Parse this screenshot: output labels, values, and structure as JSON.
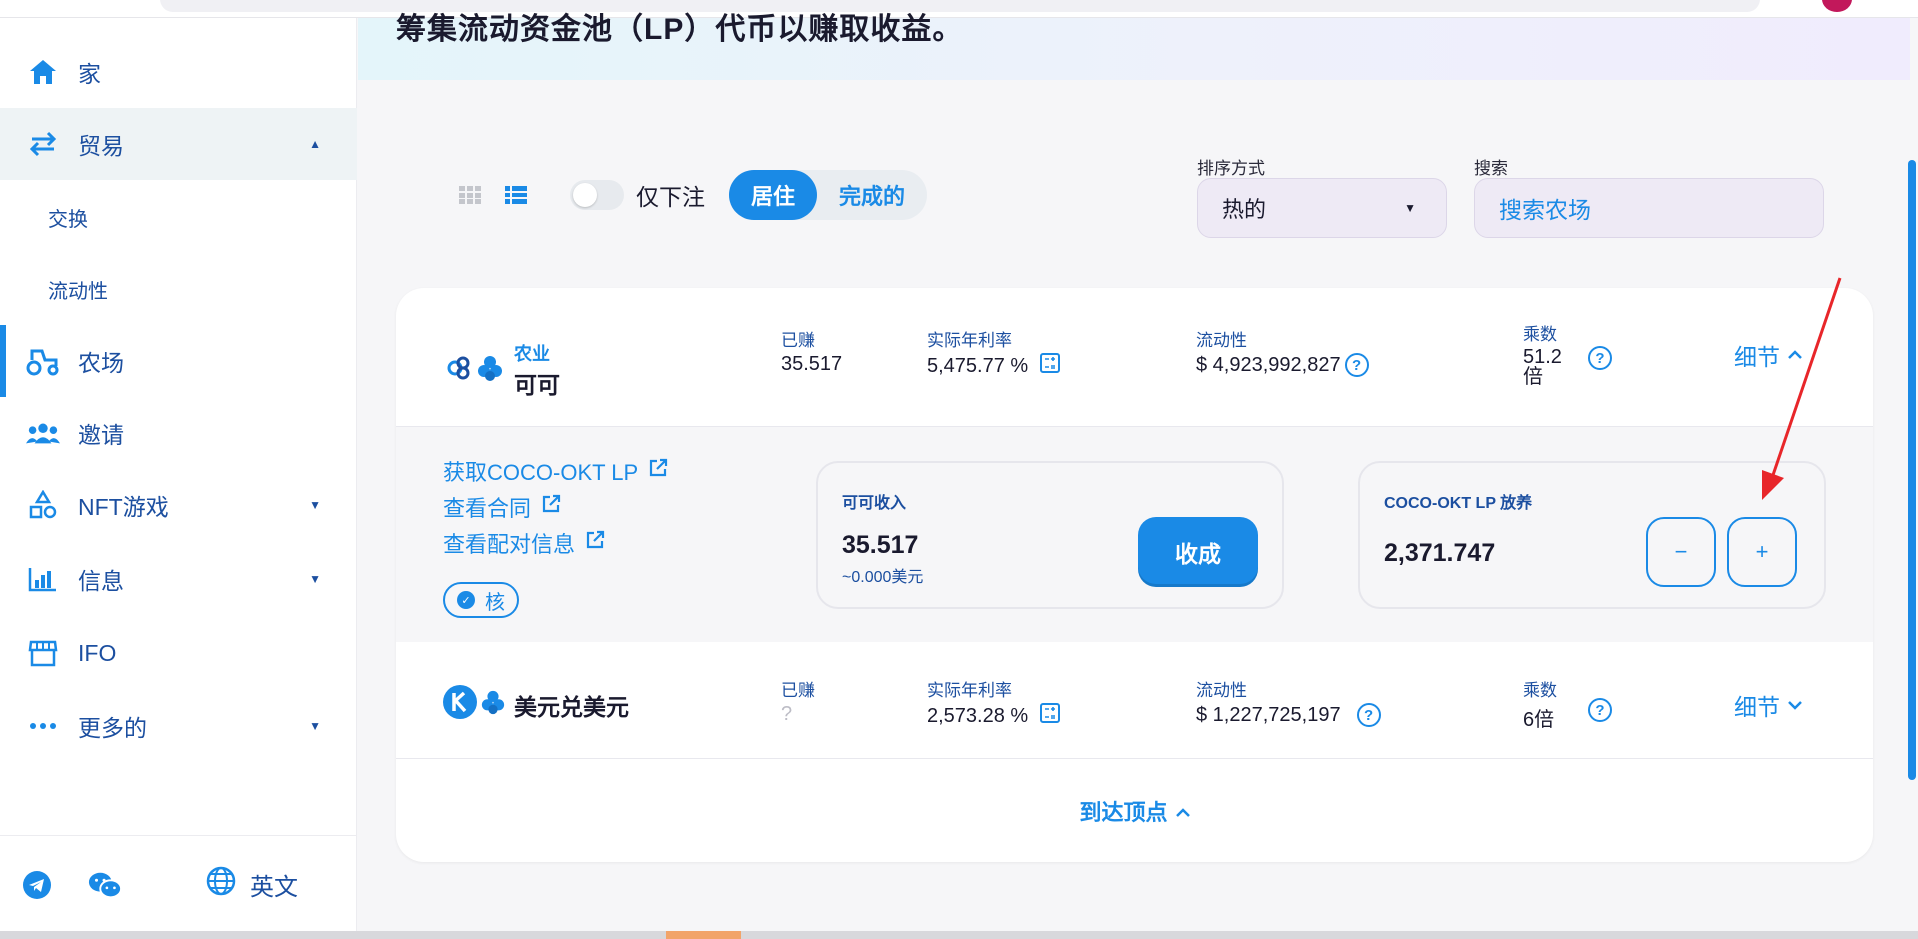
{
  "hero": {
    "title": "筹集流动资金池（LP）代币以赚取收益。"
  },
  "sidebar": {
    "items": [
      {
        "label": "家",
        "icon": "home-icon"
      },
      {
        "label": "贸易",
        "icon": "swap-arrows-icon",
        "expanded": true
      },
      {
        "label": "农场",
        "icon": "tractor-icon",
        "current": true
      },
      {
        "label": "邀请",
        "icon": "people-icon"
      },
      {
        "label": "NFT游戏",
        "icon": "shapes-icon"
      },
      {
        "label": "信息",
        "icon": "bar-chart-icon"
      },
      {
        "label": "IFO",
        "icon": "shop-icon"
      },
      {
        "label": "更多的",
        "icon": "more-dots-icon"
      }
    ],
    "sub_items": [
      {
        "label": "交换"
      },
      {
        "label": "流动性"
      }
    ],
    "footer": {
      "language": "英文"
    }
  },
  "controls": {
    "toggle_label": "仅下注",
    "tabs": [
      {
        "label": "居住",
        "active": true
      },
      {
        "label": "完成的",
        "active": false
      }
    ],
    "sort_label": "排序方式",
    "sort_value": "热的",
    "search_label": "搜索",
    "search_placeholder": "搜索农场"
  },
  "farms": [
    {
      "tag": "农业",
      "name": "可可",
      "earned_label": "已赚",
      "earned_value": "35.517",
      "apr_label": "实际年利率",
      "apr_value": "5,475.77 %",
      "liquidity_label": "流动性",
      "liquidity_value": "$ 4,923,992,827",
      "multiplier_label": "乘数",
      "multiplier_value": "51.2 倍",
      "details_label": "细节",
      "expanded": true
    },
    {
      "name": "美元兑美元",
      "earned_label": "已赚",
      "earned_value": "?",
      "apr_label": "实际年利率",
      "apr_value": "2,573.28 %",
      "liquidity_label": "流动性",
      "liquidity_value": "$ 1,227,725,197",
      "multiplier_label": "乘数",
      "multiplier_value": "6倍",
      "details_label": "细节",
      "expanded": false
    }
  ],
  "expanded_panel": {
    "links": [
      "获取COCO-OKT LP",
      "查看合同",
      "查看配对信息"
    ],
    "core_label": "核",
    "earn_title": "可可收入",
    "earn_value": "35.517",
    "earn_usd": "~0.000美元",
    "harvest_label": "收成",
    "staked_title": "COCO-OKT LP 放养",
    "staked_value": "2,371.747",
    "minus_label": "−",
    "plus_label": "+"
  },
  "back_to_top": "到达顶点",
  "colors": {
    "accent": "#1a8ae6",
    "text_blue": "#1c4fa0",
    "annotation_red": "#e8262a"
  }
}
